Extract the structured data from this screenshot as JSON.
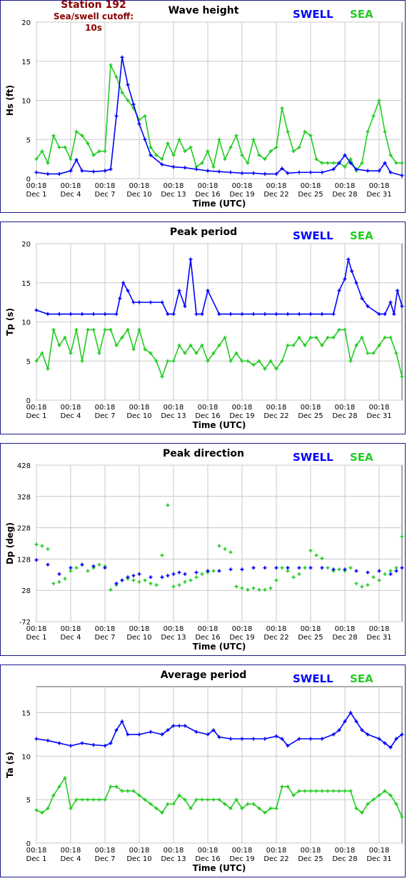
{
  "header": {
    "station": "Station 192",
    "cutoff": "Sea/swell cutoff: 10s"
  },
  "legend": {
    "swell": "SWELL",
    "sea": "SEA"
  },
  "colors": {
    "swell": "#0000ff",
    "sea": "#22cc22",
    "frame": "#1a1a8c",
    "grid": "#c8c8c8"
  },
  "x_axis": {
    "label": "Time (UTC)",
    "tick_time": "00:18",
    "tick_dates": [
      "Dec 1",
      "Dec 4",
      "Dec 7",
      "Dec 10",
      "Dec 13",
      "Dec 16",
      "Dec 19",
      "Dec 22",
      "Dec 25",
      "Dec 28",
      "Dec 31"
    ],
    "range_days": [
      1,
      33
    ]
  },
  "chart_data": [
    {
      "type": "line",
      "title": "Wave height",
      "ylabel": "Hs (ft)",
      "ylim": [
        0,
        20
      ],
      "yticks": [
        0,
        5,
        10,
        15,
        20
      ],
      "grid": true,
      "legend": "top-right",
      "series": [
        {
          "name": "SWELL",
          "x": [
            1,
            2,
            3,
            4,
            4.5,
            5,
            6,
            7,
            7.5,
            8,
            8.5,
            9,
            9.5,
            10,
            10.5,
            11,
            12,
            13,
            14,
            15,
            16,
            17,
            18,
            19,
            20,
            21,
            22,
            22.5,
            23,
            24,
            25,
            26,
            27,
            27.5,
            28,
            28.5,
            29,
            30,
            31,
            31.5,
            32,
            33
          ],
          "values": [
            0.8,
            0.6,
            0.6,
            1.0,
            2.4,
            1.0,
            0.9,
            1.0,
            1.2,
            8.0,
            15.5,
            12.0,
            9.5,
            7.0,
            5.0,
            3.0,
            1.8,
            1.5,
            1.4,
            1.2,
            1.0,
            0.9,
            0.8,
            0.7,
            0.7,
            0.6,
            0.6,
            1.3,
            0.7,
            0.8,
            0.8,
            0.8,
            1.2,
            2.0,
            3.0,
            2.0,
            1.2,
            1.0,
            1.0,
            2.0,
            0.8,
            0.4
          ]
        },
        {
          "name": "SEA",
          "x": [
            1,
            1.5,
            2,
            2.5,
            3,
            3.5,
            4,
            4.5,
            5,
            5.5,
            6,
            6.5,
            7,
            7.5,
            8,
            8.5,
            9,
            9.5,
            10,
            10.5,
            11,
            11.5,
            12,
            12.5,
            13,
            13.5,
            14,
            14.5,
            15,
            15.5,
            16,
            16.5,
            17,
            17.5,
            18,
            18.5,
            19,
            19.5,
            20,
            20.5,
            21,
            21.5,
            22,
            22.5,
            23,
            23.5,
            24,
            24.5,
            25,
            25.5,
            26,
            26.5,
            27,
            27.5,
            28,
            28.5,
            29,
            29.5,
            30,
            30.5,
            31,
            31.5,
            32,
            32.5,
            33
          ],
          "values": [
            2.5,
            3.5,
            2.0,
            5.5,
            4.0,
            4.0,
            2.5,
            6.0,
            5.5,
            4.5,
            3.0,
            3.5,
            3.5,
            14.5,
            13.0,
            11.0,
            10.0,
            9.0,
            7.5,
            8.0,
            4.0,
            3.0,
            2.5,
            4.5,
            3.0,
            5.0,
            3.5,
            4.0,
            1.5,
            2.0,
            3.5,
            1.5,
            5.0,
            2.5,
            4.0,
            5.5,
            3.0,
            2.0,
            5.0,
            3.0,
            2.5,
            3.5,
            4.0,
            9.0,
            6.0,
            3.5,
            4.0,
            6.0,
            5.5,
            2.5,
            2.0,
            2.0,
            2.0,
            2.0,
            1.5,
            2.5,
            1.0,
            2.0,
            6.0,
            8.0,
            10.0,
            6.0,
            3.0,
            2.0,
            2.0
          ]
        }
      ]
    },
    {
      "type": "line",
      "title": "Peak period",
      "ylabel": "Tp (s)",
      "ylim": [
        0,
        20
      ],
      "yticks": [
        0,
        5,
        10,
        15,
        20
      ],
      "grid": true,
      "legend": "top-right",
      "series": [
        {
          "name": "SWELL",
          "x": [
            1,
            2,
            3,
            4,
            5,
            6,
            7,
            8,
            8.3,
            8.6,
            9,
            9.5,
            10,
            11,
            12,
            12.5,
            13,
            13.5,
            14,
            14.5,
            15,
            15.5,
            16,
            17,
            18,
            19,
            20,
            21,
            22,
            23,
            24,
            25,
            26,
            27,
            27.5,
            28,
            28.3,
            28.6,
            29,
            29.5,
            30,
            31,
            31.5,
            32,
            32.3,
            32.6,
            33
          ],
          "values": [
            11.5,
            11,
            11,
            11,
            11,
            11,
            11,
            11,
            13,
            15,
            14,
            12.5,
            12.5,
            12.5,
            12.5,
            11,
            11,
            14,
            12,
            18,
            11,
            11,
            14,
            11,
            11,
            11,
            11,
            11,
            11,
            11,
            11,
            11,
            11,
            11,
            14,
            15.5,
            18,
            16.5,
            15,
            13,
            12,
            11,
            11,
            12.5,
            11,
            14,
            12
          ]
        },
        {
          "name": "SEA",
          "x": [
            1,
            1.5,
            2,
            2.5,
            3,
            3.5,
            4,
            4.5,
            5,
            5.5,
            6,
            6.5,
            7,
            7.5,
            8,
            8.5,
            9,
            9.5,
            10,
            10.5,
            11,
            11.5,
            12,
            12.5,
            13,
            13.5,
            14,
            14.5,
            15,
            15.5,
            16,
            16.5,
            17,
            17.5,
            18,
            18.5,
            19,
            19.5,
            20,
            20.5,
            21,
            21.5,
            22,
            22.5,
            23,
            23.5,
            24,
            24.5,
            25,
            25.5,
            26,
            26.5,
            27,
            27.5,
            28,
            28.5,
            29,
            29.5,
            30,
            30.5,
            31,
            31.5,
            32,
            32.5,
            33
          ],
          "values": [
            5,
            6,
            4,
            9,
            7,
            8,
            6,
            9,
            5,
            9,
            9,
            6,
            9,
            9,
            7,
            8,
            9,
            6.5,
            9,
            6.5,
            6,
            5,
            3,
            5,
            5,
            7,
            6,
            7,
            6,
            7,
            5,
            6,
            7,
            8,
            5,
            6,
            5,
            5,
            4.5,
            5,
            4,
            5,
            4,
            5,
            7,
            7,
            8,
            7,
            8,
            8,
            7,
            8,
            8,
            9,
            9,
            5,
            7,
            8,
            6,
            6,
            7,
            8,
            8,
            6,
            3
          ]
        }
      ]
    },
    {
      "type": "scatter",
      "title": "Peak direction",
      "ylabel": "Dp (deg)",
      "ylim": [
        -72,
        428
      ],
      "yticks": [
        -72,
        28,
        128,
        228,
        328,
        428
      ],
      "grid": true,
      "legend": "top-right",
      "series": [
        {
          "name": "SWELL",
          "x": [
            1,
            2,
            3,
            4,
            5,
            6,
            7,
            8,
            8.5,
            9,
            9.5,
            10,
            11,
            12,
            12.5,
            13,
            13.5,
            14,
            15,
            16,
            17,
            18,
            19,
            20,
            21,
            22,
            23,
            24,
            25,
            26,
            27,
            28,
            29,
            30,
            31,
            32,
            32.5,
            33
          ],
          "values": [
            125,
            110,
            80,
            100,
            110,
            105,
            100,
            50,
            60,
            70,
            75,
            80,
            70,
            70,
            75,
            80,
            85,
            80,
            85,
            90,
            90,
            95,
            95,
            100,
            100,
            100,
            100,
            100,
            100,
            100,
            95,
            95,
            90,
            85,
            90,
            80,
            90,
            100
          ]
        },
        {
          "name": "SEA",
          "x": [
            1,
            1.5,
            2,
            2.5,
            3,
            3.5,
            4,
            4.5,
            5,
            5.5,
            6,
            6.5,
            7,
            7.5,
            8,
            8.5,
            9,
            9.5,
            10,
            10.5,
            11,
            11.5,
            12,
            12.5,
            13,
            13.5,
            14,
            14.5,
            15,
            15.5,
            16,
            16.5,
            17,
            17.5,
            18,
            18.5,
            19,
            19.5,
            20,
            20.5,
            21,
            21.5,
            22,
            22.5,
            23,
            23.5,
            24,
            24.5,
            25,
            25.5,
            26,
            26.5,
            27,
            27.5,
            28,
            28.5,
            29,
            29.5,
            30,
            30.5,
            31,
            31.5,
            32,
            32.5,
            33
          ],
          "values": [
            175,
            170,
            160,
            50,
            55,
            65,
            90,
            100,
            110,
            90,
            100,
            110,
            105,
            30,
            45,
            60,
            65,
            60,
            55,
            60,
            50,
            45,
            140,
            300,
            40,
            45,
            55,
            60,
            70,
            80,
            85,
            90,
            170,
            160,
            150,
            40,
            35,
            30,
            35,
            30,
            30,
            35,
            60,
            100,
            90,
            70,
            80,
            100,
            155,
            140,
            130,
            100,
            90,
            95,
            90,
            100,
            50,
            40,
            45,
            70,
            60,
            80,
            90,
            100,
            200
          ]
        }
      ]
    },
    {
      "type": "line",
      "title": "Average period",
      "ylabel": "Ta (s)",
      "ylim": [
        0,
        18
      ],
      "yticks": [
        0,
        5,
        10,
        15
      ],
      "grid": true,
      "legend": "top-right",
      "series": [
        {
          "name": "SWELL",
          "x": [
            1,
            2,
            3,
            4,
            5,
            6,
            7,
            7.5,
            8,
            8.5,
            9,
            10,
            11,
            12,
            12.5,
            13,
            13.5,
            14,
            15,
            16,
            16.5,
            17,
            18,
            19,
            20,
            21,
            22,
            22.5,
            23,
            24,
            25,
            26,
            27,
            27.5,
            28,
            28.5,
            29,
            29.5,
            30,
            31,
            31.5,
            32,
            32.5,
            33
          ],
          "values": [
            12,
            11.8,
            11.5,
            11.2,
            11.5,
            11.3,
            11.2,
            11.5,
            13,
            14,
            12.5,
            12.5,
            12.8,
            12.5,
            13,
            13.5,
            13.5,
            13.5,
            12.8,
            12.5,
            13,
            12.2,
            12,
            12,
            12,
            12,
            12.3,
            12,
            11.2,
            12,
            12,
            12,
            12.5,
            13,
            14,
            15,
            14,
            13,
            12.5,
            12,
            11.5,
            11,
            12,
            12.5
          ]
        },
        {
          "name": "SEA",
          "x": [
            1,
            1.5,
            2,
            2.5,
            3,
            3.5,
            4,
            4.5,
            5,
            5.5,
            6,
            6.5,
            7,
            7.5,
            8,
            8.5,
            9,
            9.5,
            10,
            10.5,
            11,
            11.5,
            12,
            12.5,
            13,
            13.5,
            14,
            14.5,
            15,
            15.5,
            16,
            16.5,
            17,
            17.5,
            18,
            18.5,
            19,
            19.5,
            20,
            20.5,
            21,
            21.5,
            22,
            22.5,
            23,
            23.5,
            24,
            24.5,
            25,
            25.5,
            26,
            26.5,
            27,
            27.5,
            28,
            28.5,
            29,
            29.5,
            30,
            30.5,
            31,
            31.5,
            32,
            32.5,
            33
          ],
          "values": [
            3.8,
            3.5,
            4,
            5.5,
            6.5,
            7.5,
            4,
            5,
            5,
            5,
            5,
            5,
            5,
            6.5,
            6.5,
            6,
            6,
            6,
            5.5,
            5,
            4.5,
            4,
            3.5,
            4.5,
            4.5,
            5.5,
            5,
            4,
            5,
            5,
            5,
            5,
            5,
            4.5,
            4,
            5,
            4,
            4.5,
            4.5,
            4,
            3.5,
            4,
            4,
            6.5,
            6.5,
            5.5,
            6,
            6,
            6,
            6,
            6,
            6,
            6,
            6,
            6,
            6,
            4,
            3.5,
            4.5,
            5,
            5.5,
            6,
            5.5,
            4.5,
            3
          ]
        }
      ]
    }
  ]
}
